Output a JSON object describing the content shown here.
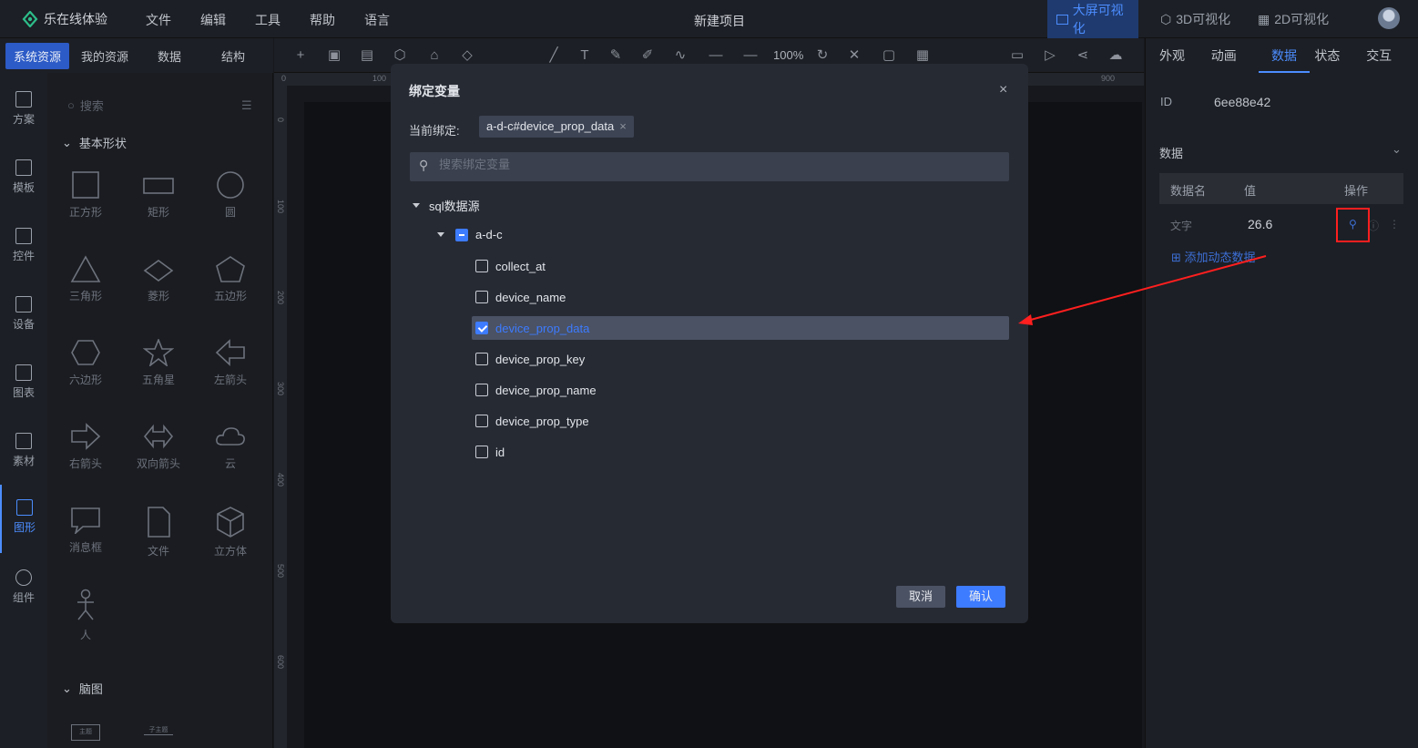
{
  "app": {
    "brand": "乐在线体验",
    "title": "新建项目"
  },
  "menu": [
    "文件",
    "编辑",
    "工具",
    "帮助",
    "语言"
  ],
  "viz_modes": [
    {
      "label": "大屏可视化",
      "active": true
    },
    {
      "label": "3D可视化"
    },
    {
      "label": "2D可视化"
    }
  ],
  "left_tabs": [
    "系统资源",
    "我的资源",
    "数据",
    "结构"
  ],
  "side_nav": [
    "方案",
    "模板",
    "控件",
    "设备",
    "图表",
    "素材",
    "图形",
    "组件"
  ],
  "shape_panel": {
    "search_placeholder": "搜索",
    "section_basic": "基本形状",
    "section_brain": "脑图",
    "shapes": [
      "正方形",
      "矩形",
      "圆",
      "三角形",
      "菱形",
      "五边形",
      "六边形",
      "五角星",
      "左箭头",
      "右箭头",
      "双向箭头",
      "云",
      "消息框",
      "文件",
      "立方体",
      "人"
    ],
    "brain_items": [
      "主题",
      "子主题"
    ]
  },
  "toolbar": {
    "zoom": "100%"
  },
  "ruler": {
    "h": [
      "0",
      "100",
      "900"
    ],
    "v": [
      "0",
      "100",
      "200",
      "300",
      "400",
      "500",
      "600"
    ]
  },
  "right_panel": {
    "tabs": [
      "外观",
      "动画",
      "数据",
      "状态",
      "交互"
    ],
    "id_label": "ID",
    "id_value": "6ee88e42",
    "data_title": "数据",
    "columns": [
      "数据名",
      "值",
      "操作"
    ],
    "row": {
      "name": "文字",
      "value": "26.6"
    },
    "add_label": "添加动态数据"
  },
  "modal": {
    "title": "绑定变量",
    "current_label": "当前绑定:",
    "current_tag": "a-d-c#device_prop_data",
    "search_placeholder": "搜索绑定变量",
    "root": "sql数据源",
    "child": "a-d-c",
    "fields": [
      {
        "name": "collect_at",
        "checked": false
      },
      {
        "name": "device_name",
        "checked": false
      },
      {
        "name": "device_prop_data",
        "checked": true
      },
      {
        "name": "device_prop_key",
        "checked": false
      },
      {
        "name": "device_prop_name",
        "checked": false
      },
      {
        "name": "device_prop_type",
        "checked": false
      },
      {
        "name": "id",
        "checked": false
      }
    ],
    "cancel": "取消",
    "ok": "确认"
  },
  "colors": {
    "accent": "#3d7bff",
    "annotation": "#ff1f1f"
  }
}
